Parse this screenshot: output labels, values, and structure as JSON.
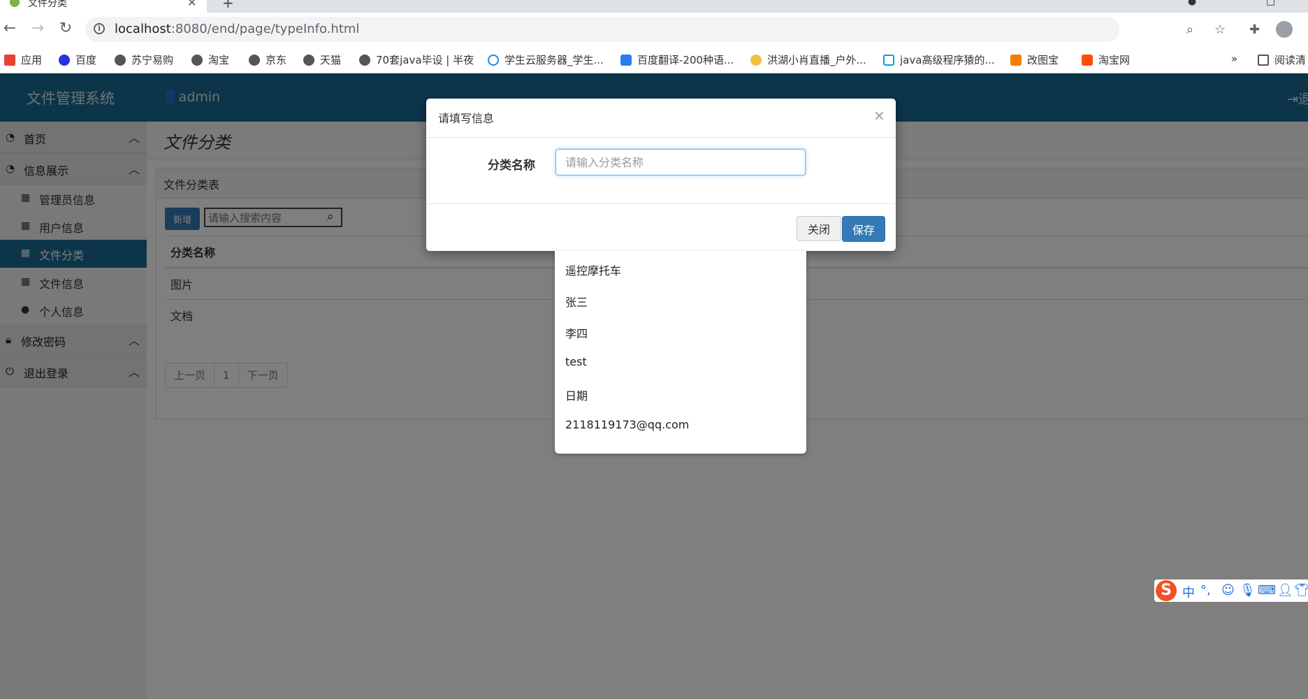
{
  "browser": {
    "tab_title": "文件分类",
    "url_host": "localhost",
    "url_path": ":8080/end/page/typeInfo.html",
    "bookmarks": [
      {
        "label": "应用"
      },
      {
        "label": "百度"
      },
      {
        "label": "苏宁易购"
      },
      {
        "label": "淘宝"
      },
      {
        "label": "京东"
      },
      {
        "label": "天猫"
      },
      {
        "label": "70套java毕设 | 半夜"
      },
      {
        "label": "学生云服务器_学生..."
      },
      {
        "label": "百度翻译-200种语..."
      },
      {
        "label": "洪湖小肖直播_户外..."
      },
      {
        "label": "java高级程序猿的..."
      },
      {
        "label": "改图宝"
      },
      {
        "label": "淘宝网"
      },
      {
        "label": "阅读清"
      }
    ],
    "more": "»"
  },
  "app": {
    "brand": "文件管理系统",
    "user": "admin",
    "logout_top": "退"
  },
  "sidebar": {
    "home": "首页",
    "info_group": "信息展示",
    "items": [
      {
        "label": "管理员信息"
      },
      {
        "label": "用户信息"
      },
      {
        "label": "文件分类"
      },
      {
        "label": "文件信息"
      },
      {
        "label": "个人信息"
      }
    ],
    "change_password": "修改密码",
    "logout": "退出登录"
  },
  "content": {
    "page_title": "文件分类",
    "panel_title": "文件分类表",
    "new_button": "新增",
    "search_placeholder": "请输入搜索内容",
    "table": {
      "header": "分类名称",
      "rows": [
        "图片",
        "文档"
      ]
    },
    "pager": {
      "prev": "上一页",
      "page": "1",
      "next": "下一页"
    }
  },
  "modal": {
    "title": "请填写信息",
    "close_symbol": "×",
    "field_label": "分类名称",
    "field_placeholder": "请输入分类名称",
    "close_button": "关闭",
    "save_button": "保存"
  },
  "autocomplete": [
    "遥控摩托车",
    "张三",
    "李四",
    "test",
    "日期",
    "2118119173@qq.com"
  ],
  "ime": {
    "logo": "S",
    "mode": "中"
  },
  "colors": {
    "header": "#1a6b93",
    "primary": "#337ab7",
    "active_menu": "#1a6b93"
  }
}
